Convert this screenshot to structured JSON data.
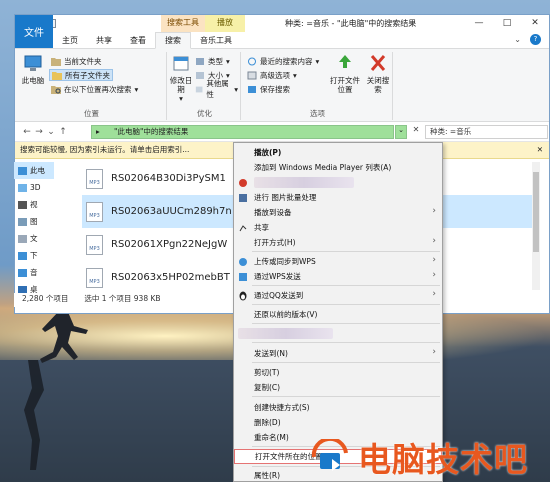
{
  "window": {
    "title": "种类: =音乐 - \"此电脑\"中的搜索结果",
    "contextual_tabs": {
      "search_tools": "搜索工具",
      "play": "播放"
    },
    "tabs": [
      {
        "label": "文件"
      },
      {
        "label": "主页"
      },
      {
        "label": "共享"
      },
      {
        "label": "查看"
      },
      {
        "label": "搜索"
      },
      {
        "label": "音乐工具"
      }
    ],
    "controls": {
      "minimize": "—",
      "maximize": "□",
      "close": "✕"
    },
    "help": "?"
  },
  "ribbon": {
    "location": {
      "this_pc": "此电脑",
      "current_folder": "当前文件夹",
      "all_subfolders": "所有子文件夹",
      "search_again": "在以下位置再次搜索",
      "group_label": "位置"
    },
    "refine": {
      "modified_date": "修改日期",
      "type": "类型",
      "size": "大小",
      "other_props": "其他属性",
      "group_label": "优化"
    },
    "options": {
      "recent": "最近的搜索内容",
      "advanced": "高级选项",
      "save_search": "保存搜索",
      "open_location": "打开文件位置",
      "close_search": "关闭搜索",
      "group_label": "选项"
    }
  },
  "address_bar": {
    "path": "\"此电脑\"中的搜索结果",
    "search_value": "种类: =音乐"
  },
  "info_bar": {
    "text": "搜索可能较慢, 因为索引未运行。请单击启用索引...",
    "close": "✕"
  },
  "nav_pane": {
    "items": [
      {
        "label": "此电"
      },
      {
        "label": "3D"
      },
      {
        "label": "视"
      },
      {
        "label": "图"
      },
      {
        "label": "文"
      },
      {
        "label": "下"
      },
      {
        "label": "音"
      },
      {
        "label": "桌"
      }
    ]
  },
  "files": [
    {
      "name": "RS02064B30Di3PySM1",
      "icon_label": "MP3"
    },
    {
      "name": "RS02063aUUCm289h7n",
      "icon_label": "MP3"
    },
    {
      "name": "RS02061XPgn22NeJgW",
      "icon_label": "MP3"
    },
    {
      "name": "RS02063x5HP02mebBT",
      "icon_label": "MP3"
    }
  ],
  "status_bar": {
    "count": "2,280 个项目",
    "selected": "选中 1 个项目  938 KB"
  },
  "context_menu": {
    "items": [
      {
        "label": "播放(P)",
        "bold": true
      },
      {
        "label": "添加到 Windows Media Player 列表(A)"
      },
      {
        "label": "进行 图片批量处理"
      },
      {
        "label": "播放到设备"
      },
      {
        "label": "共享"
      },
      {
        "label": "打开方式(H)"
      },
      {
        "label": "上传或同步到WPS"
      },
      {
        "label": "通过WPS发送"
      },
      {
        "label": "通过QQ发送到"
      },
      {
        "label": "还原以前的版本(V)"
      },
      {
        "label": "发送到(N)"
      },
      {
        "label": "剪切(T)"
      },
      {
        "label": "复制(C)"
      },
      {
        "label": "创建快捷方式(S)"
      },
      {
        "label": "删除(D)"
      },
      {
        "label": "重命名(M)"
      },
      {
        "label": "打开文件所在的位置(I)"
      },
      {
        "label": "属性(R)"
      }
    ]
  },
  "watermark": {
    "text": "电脑技术吧"
  }
}
